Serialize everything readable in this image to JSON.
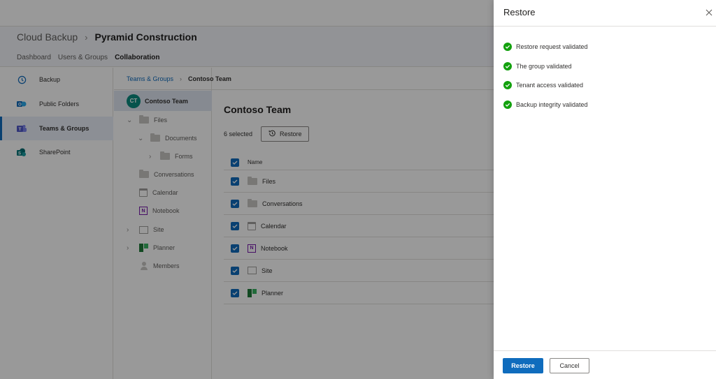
{
  "header": {
    "app": "Cloud Backup",
    "org": "Pyramid Construction",
    "tabs": [
      "Dashboard",
      "Users & Groups",
      "Collaboration"
    ],
    "active_tab": "Collaboration"
  },
  "sidebar": {
    "items": [
      {
        "label": "Backup",
        "icon": "history-icon"
      },
      {
        "label": "Public Folders",
        "icon": "public-folders-icon"
      },
      {
        "label": "Teams & Groups",
        "icon": "teams-icon"
      },
      {
        "label": "SharePoint",
        "icon": "sharepoint-icon"
      }
    ],
    "active": "Teams & Groups"
  },
  "breadcrumb": {
    "parent": "Teams & Groups",
    "current": "Contoso Team"
  },
  "tree": {
    "team_initials": "CT",
    "team": "Contoso Team",
    "nodes": [
      "Files",
      "Documents",
      "Forms",
      "Conversations",
      "Calendar",
      "Notebook",
      "Site",
      "Planner",
      "Members"
    ]
  },
  "main": {
    "title": "Contoso Team",
    "selected": "6 selected",
    "restore_label": "Restore",
    "column_name": "Name",
    "rows": [
      "Files",
      "Conversations",
      "Calendar",
      "Notebook",
      "Site",
      "Planner"
    ]
  },
  "panel": {
    "title": "Restore",
    "checks": [
      "Restore request validated",
      "The group validated",
      "Tenant access validated",
      "Backup integrity validated"
    ],
    "primary": "Restore",
    "cancel": "Cancel"
  },
  "colors": {
    "accent": "#0f6cbd",
    "success": "#13a10e",
    "avatar": "#0b8a7f"
  }
}
